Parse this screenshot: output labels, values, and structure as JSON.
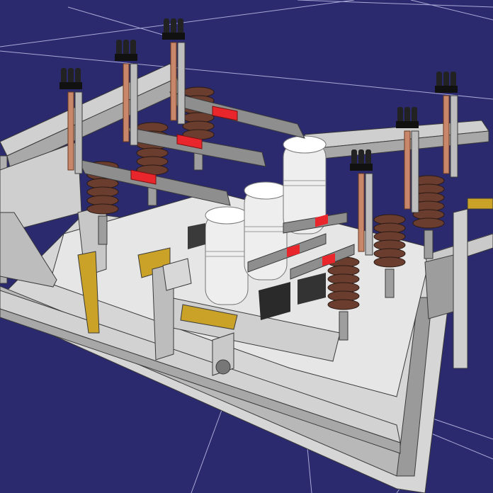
{
  "viewport": {
    "background": "#2b2a6e",
    "grid_color": "#c9c8f0"
  },
  "model": {
    "frame_color": "#c8c8c8",
    "frame_edge": "#3a3a3a",
    "insulator_color": "#6b3d2e",
    "breaker_color": "#eeeeee",
    "busbar_color": "#8e8e8e",
    "phase_mark_color": "#e8262b",
    "copper_color": "#c8876b",
    "brass_color": "#c9a227",
    "contact_color": "#222222"
  }
}
